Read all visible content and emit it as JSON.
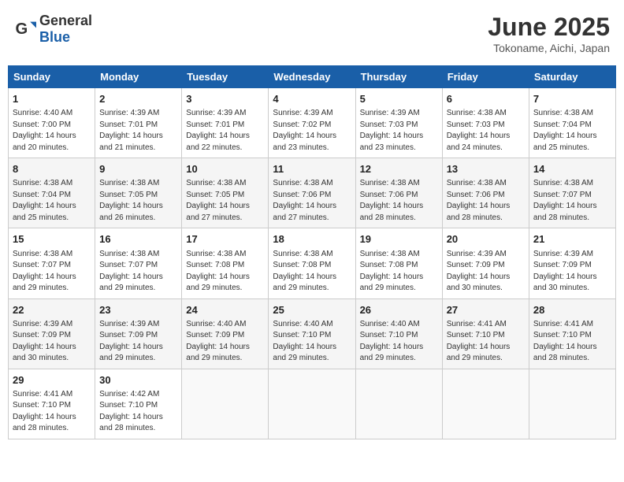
{
  "header": {
    "logo_general": "General",
    "logo_blue": "Blue",
    "title": "June 2025",
    "subtitle": "Tokoname, Aichi, Japan"
  },
  "weekdays": [
    "Sunday",
    "Monday",
    "Tuesday",
    "Wednesday",
    "Thursday",
    "Friday",
    "Saturday"
  ],
  "weeks": [
    [
      {
        "day": "1",
        "sunrise": "Sunrise: 4:40 AM",
        "sunset": "Sunset: 7:00 PM",
        "daylight": "Daylight: 14 hours and 20 minutes."
      },
      {
        "day": "2",
        "sunrise": "Sunrise: 4:39 AM",
        "sunset": "Sunset: 7:01 PM",
        "daylight": "Daylight: 14 hours and 21 minutes."
      },
      {
        "day": "3",
        "sunrise": "Sunrise: 4:39 AM",
        "sunset": "Sunset: 7:01 PM",
        "daylight": "Daylight: 14 hours and 22 minutes."
      },
      {
        "day": "4",
        "sunrise": "Sunrise: 4:39 AM",
        "sunset": "Sunset: 7:02 PM",
        "daylight": "Daylight: 14 hours and 23 minutes."
      },
      {
        "day": "5",
        "sunrise": "Sunrise: 4:39 AM",
        "sunset": "Sunset: 7:03 PM",
        "daylight": "Daylight: 14 hours and 23 minutes."
      },
      {
        "day": "6",
        "sunrise": "Sunrise: 4:38 AM",
        "sunset": "Sunset: 7:03 PM",
        "daylight": "Daylight: 14 hours and 24 minutes."
      },
      {
        "day": "7",
        "sunrise": "Sunrise: 4:38 AM",
        "sunset": "Sunset: 7:04 PM",
        "daylight": "Daylight: 14 hours and 25 minutes."
      }
    ],
    [
      {
        "day": "8",
        "sunrise": "Sunrise: 4:38 AM",
        "sunset": "Sunset: 7:04 PM",
        "daylight": "Daylight: 14 hours and 25 minutes."
      },
      {
        "day": "9",
        "sunrise": "Sunrise: 4:38 AM",
        "sunset": "Sunset: 7:05 PM",
        "daylight": "Daylight: 14 hours and 26 minutes."
      },
      {
        "day": "10",
        "sunrise": "Sunrise: 4:38 AM",
        "sunset": "Sunset: 7:05 PM",
        "daylight": "Daylight: 14 hours and 27 minutes."
      },
      {
        "day": "11",
        "sunrise": "Sunrise: 4:38 AM",
        "sunset": "Sunset: 7:06 PM",
        "daylight": "Daylight: 14 hours and 27 minutes."
      },
      {
        "day": "12",
        "sunrise": "Sunrise: 4:38 AM",
        "sunset": "Sunset: 7:06 PM",
        "daylight": "Daylight: 14 hours and 28 minutes."
      },
      {
        "day": "13",
        "sunrise": "Sunrise: 4:38 AM",
        "sunset": "Sunset: 7:06 PM",
        "daylight": "Daylight: 14 hours and 28 minutes."
      },
      {
        "day": "14",
        "sunrise": "Sunrise: 4:38 AM",
        "sunset": "Sunset: 7:07 PM",
        "daylight": "Daylight: 14 hours and 28 minutes."
      }
    ],
    [
      {
        "day": "15",
        "sunrise": "Sunrise: 4:38 AM",
        "sunset": "Sunset: 7:07 PM",
        "daylight": "Daylight: 14 hours and 29 minutes."
      },
      {
        "day": "16",
        "sunrise": "Sunrise: 4:38 AM",
        "sunset": "Sunset: 7:07 PM",
        "daylight": "Daylight: 14 hours and 29 minutes."
      },
      {
        "day": "17",
        "sunrise": "Sunrise: 4:38 AM",
        "sunset": "Sunset: 7:08 PM",
        "daylight": "Daylight: 14 hours and 29 minutes."
      },
      {
        "day": "18",
        "sunrise": "Sunrise: 4:38 AM",
        "sunset": "Sunset: 7:08 PM",
        "daylight": "Daylight: 14 hours and 29 minutes."
      },
      {
        "day": "19",
        "sunrise": "Sunrise: 4:38 AM",
        "sunset": "Sunset: 7:08 PM",
        "daylight": "Daylight: 14 hours and 29 minutes."
      },
      {
        "day": "20",
        "sunrise": "Sunrise: 4:39 AM",
        "sunset": "Sunset: 7:09 PM",
        "daylight": "Daylight: 14 hours and 30 minutes."
      },
      {
        "day": "21",
        "sunrise": "Sunrise: 4:39 AM",
        "sunset": "Sunset: 7:09 PM",
        "daylight": "Daylight: 14 hours and 30 minutes."
      }
    ],
    [
      {
        "day": "22",
        "sunrise": "Sunrise: 4:39 AM",
        "sunset": "Sunset: 7:09 PM",
        "daylight": "Daylight: 14 hours and 30 minutes."
      },
      {
        "day": "23",
        "sunrise": "Sunrise: 4:39 AM",
        "sunset": "Sunset: 7:09 PM",
        "daylight": "Daylight: 14 hours and 29 minutes."
      },
      {
        "day": "24",
        "sunrise": "Sunrise: 4:40 AM",
        "sunset": "Sunset: 7:09 PM",
        "daylight": "Daylight: 14 hours and 29 minutes."
      },
      {
        "day": "25",
        "sunrise": "Sunrise: 4:40 AM",
        "sunset": "Sunset: 7:10 PM",
        "daylight": "Daylight: 14 hours and 29 minutes."
      },
      {
        "day": "26",
        "sunrise": "Sunrise: 4:40 AM",
        "sunset": "Sunset: 7:10 PM",
        "daylight": "Daylight: 14 hours and 29 minutes."
      },
      {
        "day": "27",
        "sunrise": "Sunrise: 4:41 AM",
        "sunset": "Sunset: 7:10 PM",
        "daylight": "Daylight: 14 hours and 29 minutes."
      },
      {
        "day": "28",
        "sunrise": "Sunrise: 4:41 AM",
        "sunset": "Sunset: 7:10 PM",
        "daylight": "Daylight: 14 hours and 28 minutes."
      }
    ],
    [
      {
        "day": "29",
        "sunrise": "Sunrise: 4:41 AM",
        "sunset": "Sunset: 7:10 PM",
        "daylight": "Daylight: 14 hours and 28 minutes."
      },
      {
        "day": "30",
        "sunrise": "Sunrise: 4:42 AM",
        "sunset": "Sunset: 7:10 PM",
        "daylight": "Daylight: 14 hours and 28 minutes."
      },
      null,
      null,
      null,
      null,
      null
    ]
  ]
}
